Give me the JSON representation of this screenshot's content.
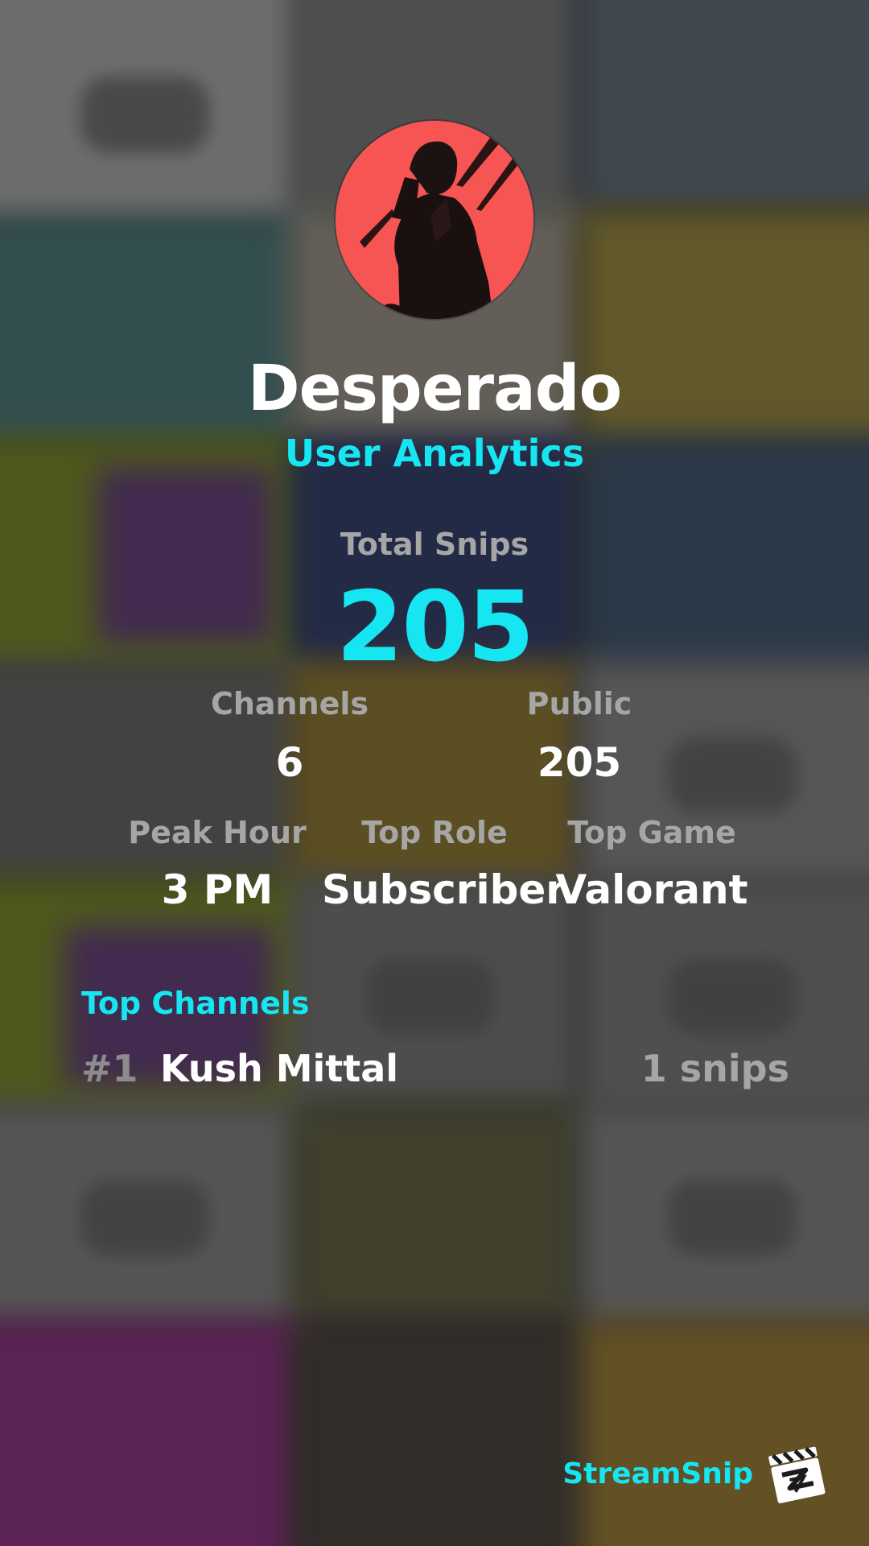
{
  "profile": {
    "username": "Desperado",
    "subtitle": "User Analytics"
  },
  "stats": {
    "total_snips_label": "Total Snips",
    "total_snips_value": "205",
    "channels_label": "Channels",
    "channels_value": "6",
    "public_label": "Public",
    "public_value": "205",
    "peak_hour_label": "Peak Hour",
    "peak_hour_value": "3 PM",
    "top_role_label": "Top Role",
    "top_role_value": "Subscriber",
    "top_game_label": "Top Game",
    "top_game_value": "Valorant"
  },
  "top_channels": {
    "title": "Top Channels",
    "items": [
      {
        "rank": "#1",
        "name": "Kush Mittal",
        "snips": "1 snips"
      }
    ]
  },
  "brand": {
    "name": "StreamSnip",
    "logo_icon": "clapperboard-icon"
  },
  "colors": {
    "accent": "#15e6f2",
    "avatar_bg": "#f65553",
    "muted_label": "#a6a6a6",
    "rank": "#8c8c8c"
  }
}
